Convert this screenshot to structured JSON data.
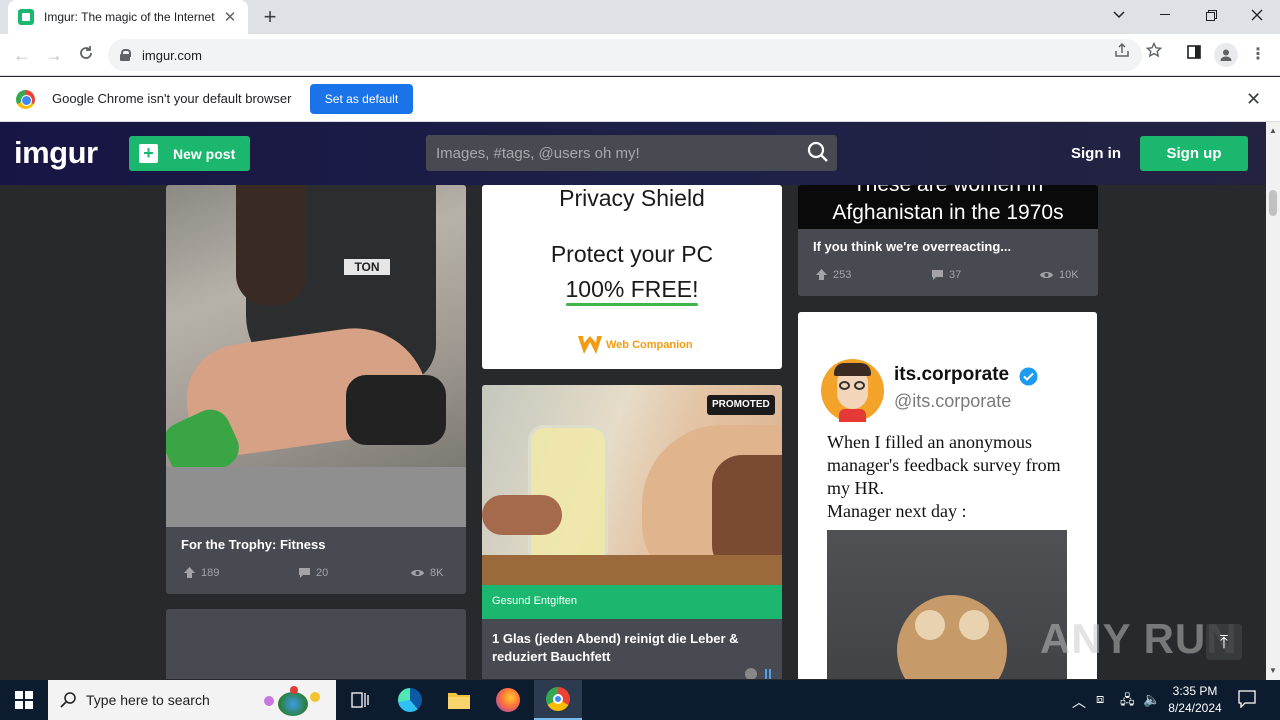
{
  "browser": {
    "tab_title": "Imgur: The magic of the Internet",
    "url": "imgur.com",
    "infobar_text": "Google Chrome isn't your default browser",
    "set_default_label": "Set as default"
  },
  "imgur": {
    "logo": "imgur",
    "new_post_label": "New post",
    "search_placeholder": "Images, #tags, @users oh my!",
    "sign_in_label": "Sign in",
    "sign_up_label": "Sign up"
  },
  "posts": [
    {
      "title": "For the Trophy: Fitness",
      "upvotes": "189",
      "comments": "20",
      "views": "8K"
    },
    {
      "title": "If you think we're overreacting...",
      "upvotes": "253",
      "comments": "37",
      "views": "10K",
      "image_text": "These are women in Afghanistan in the 1970s"
    },
    {
      "image_username": "its.corporate",
      "image_handle": "@its.corporate",
      "image_caption": "When I filled an anonymous manager's feedback survey from my HR.\nManager next day :"
    }
  ],
  "ad": {
    "line1": "Privacy Shield",
    "line2": "Protect your PC",
    "line3": "100% FREE!",
    "brand": "Web Companion"
  },
  "promoted": {
    "badge": "PROMOTED",
    "sponsor": "Gesund Entgiften",
    "title": "1 Glas (jeden Abend) reinigt die Leber & reduziert Bauchfett"
  },
  "watermark": "ANY RUN",
  "taskbar": {
    "search_placeholder": "Type here to search",
    "time": "3:35 PM",
    "date": "8/24/2024"
  },
  "colors": {
    "imgur_green": "#1bb76e",
    "card_bg": "#474a51",
    "page_bg": "#27292d"
  }
}
